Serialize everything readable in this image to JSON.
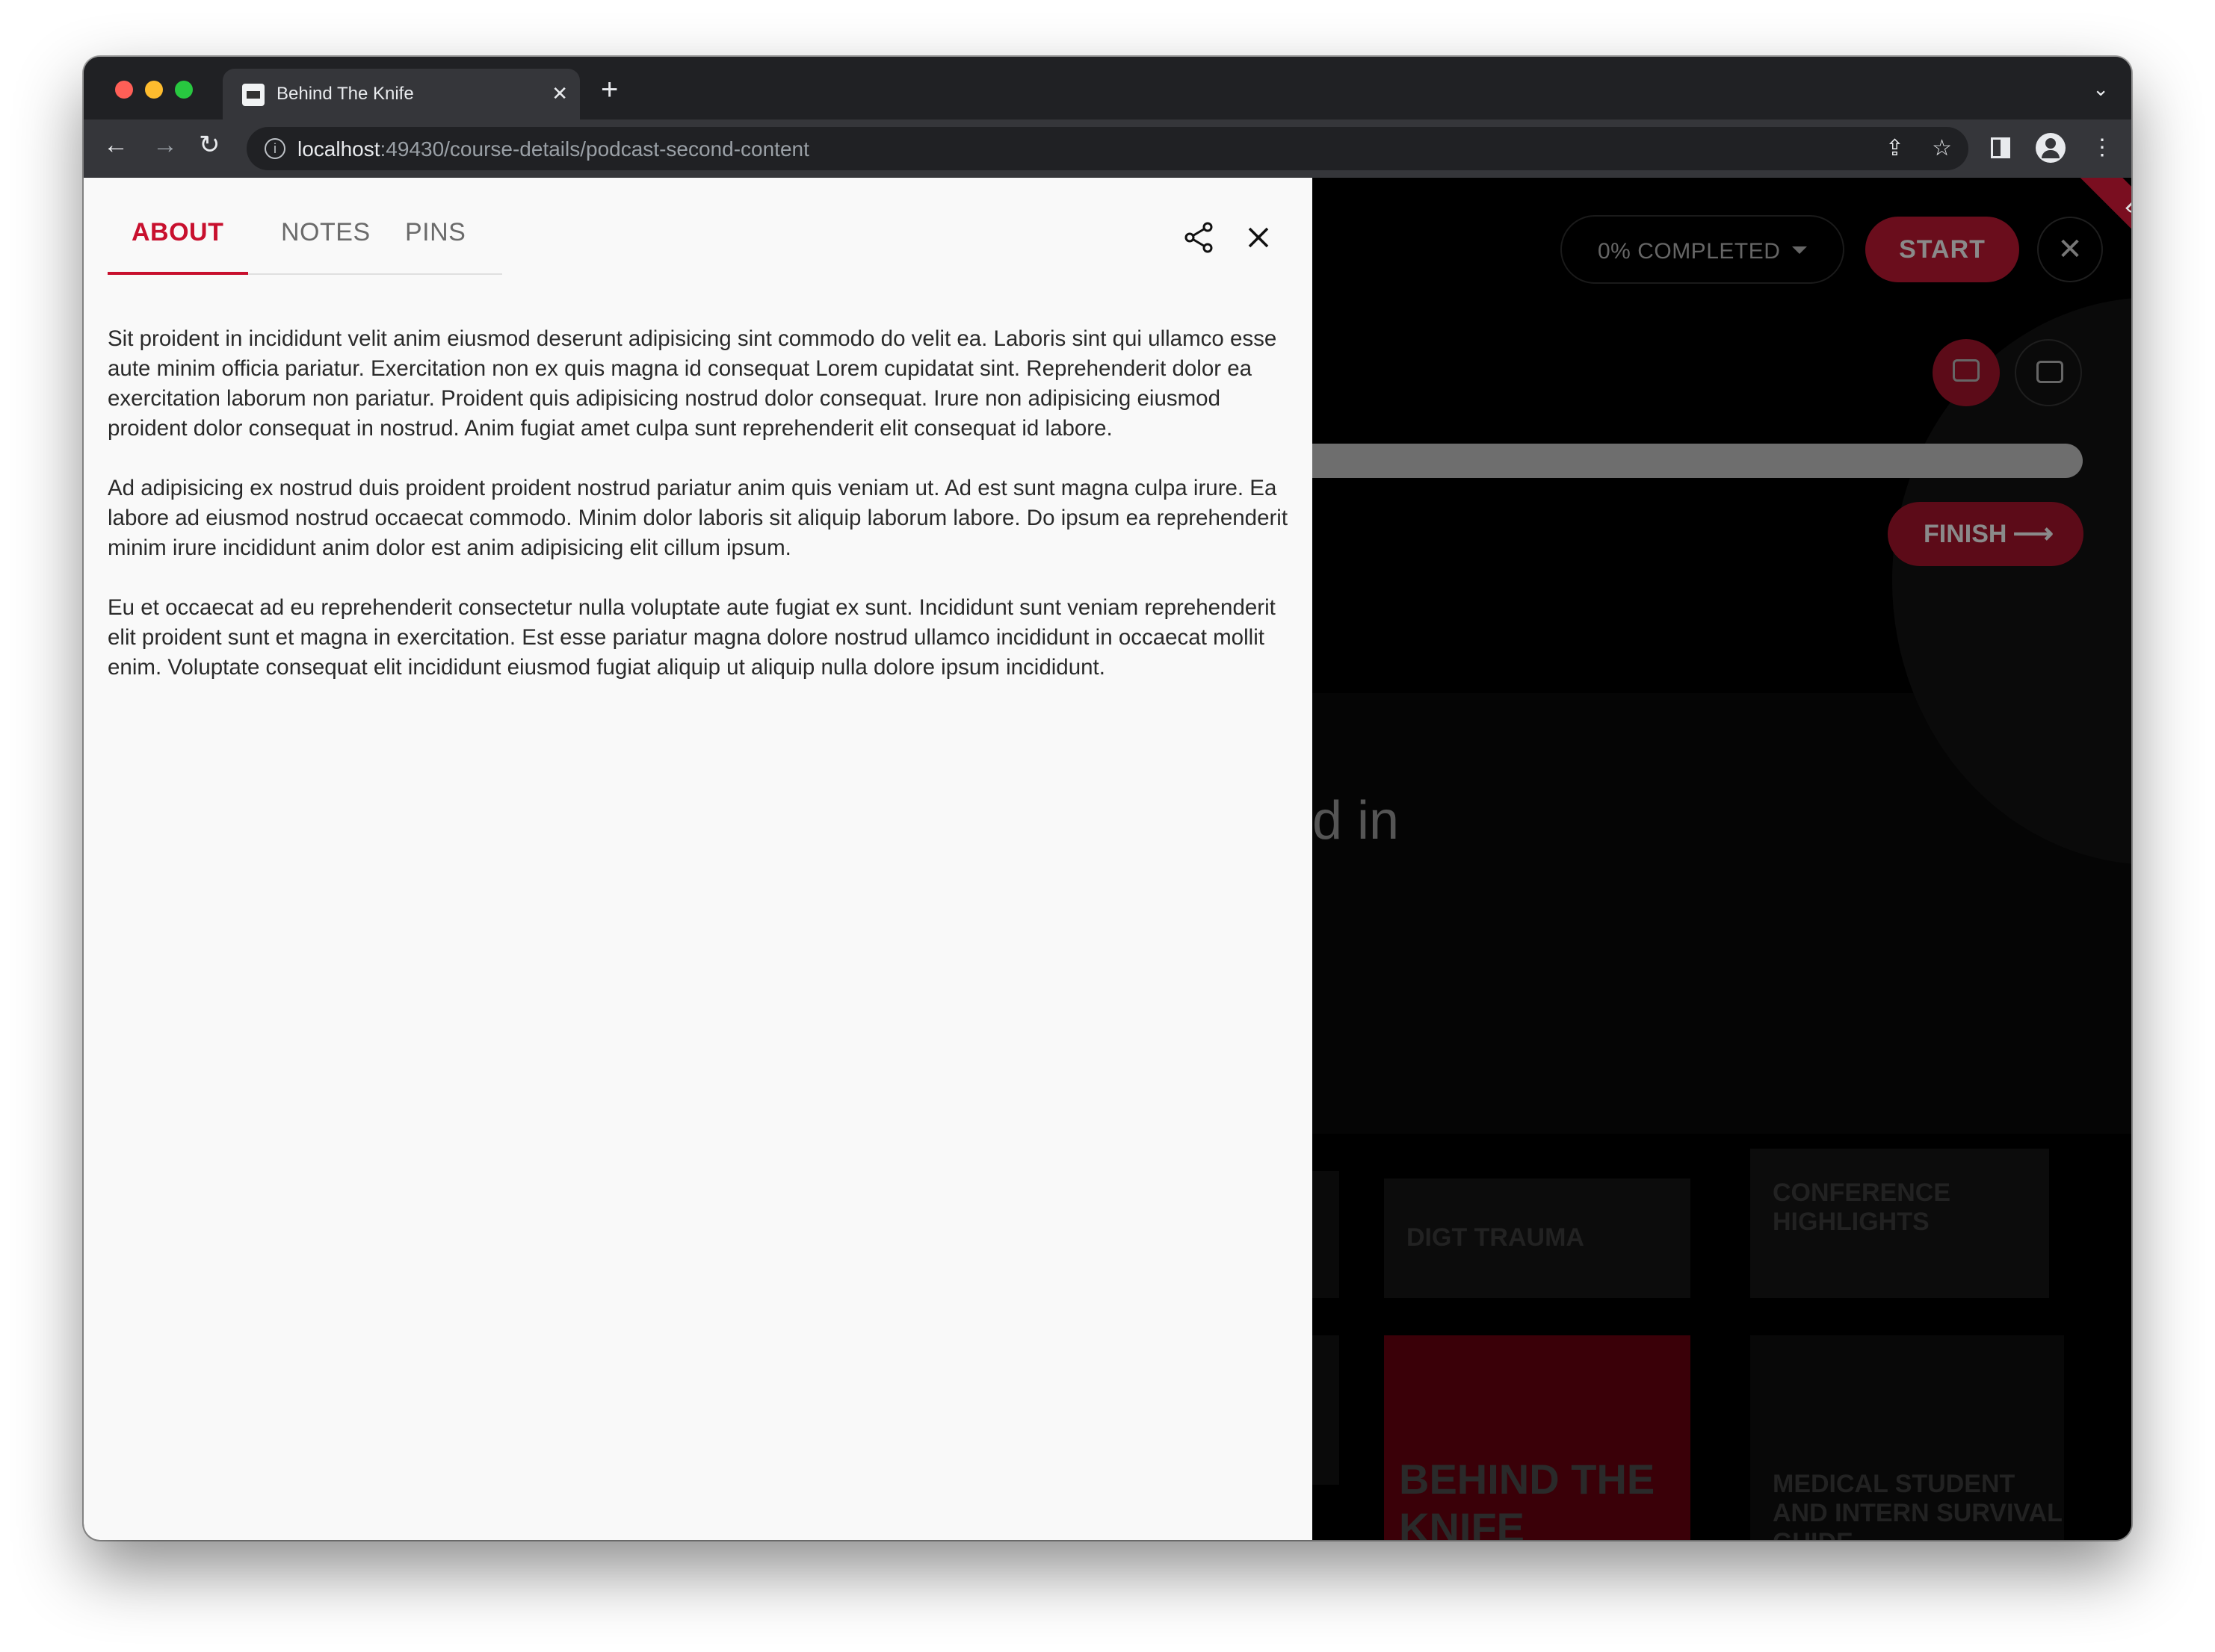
{
  "browser": {
    "tab_title": "Behind The Knife",
    "url_host": "localhost",
    "url_path": ":49430/course-details/podcast-second-content"
  },
  "drawer": {
    "tabs": [
      "ABOUT",
      "NOTES",
      "PINS"
    ],
    "active_tab": "ABOUT",
    "paragraphs": [
      "Sit proident in incididunt velit anim eiusmod deserunt adipisicing sint commodo do velit ea. Laboris sint qui ullamco esse aute minim officia pariatur. Exercitation non ex quis magna id consequat Lorem cupidatat sint. Reprehenderit dolor ea exercitation laborum non pariatur. Proident quis adipisicing nostrud dolor consequat. Irure non adipisicing eiusmod proident dolor consequat in nostrud. Anim fugiat amet culpa sunt reprehenderit elit consequat id labore.",
      "Ad adipisicing ex nostrud duis proident proident nostrud pariatur anim quis veniam ut. Ad est sunt magna culpa irure. Ea labore ad eiusmod nostrud occaecat commodo. Minim dolor laboris sit aliquip laborum labore. Do ipsum ea reprehenderit minim irure incididunt anim dolor est anim adipisicing elit cillum ipsum.",
      "Eu et occaecat ad eu reprehenderit consectetur nulla voluptate aute fugiat ex sunt. Incididunt sunt veniam reprehenderit elit proident sunt et magna in exercitation. Est esse pariatur magna dolore nostrud ullamco incididunt in occaecat mollit enim. Voluptate consequat elit incididunt eiusmod fugiat aliquip ut aliquip nulla dolore ipsum incididunt."
    ]
  },
  "background_page": {
    "completed_label": "0% COMPLETED",
    "start_label": "START",
    "finish_label": "FINISH",
    "dev_badge": "DEV",
    "heading_fragment": "d in",
    "cards": [
      "DIGT TRAUMA",
      "CONFERENCE HIGHLIGHTS",
      "BEHIND THE KNIFE",
      "MEDICAL STUDENT AND INTERN SURVIVAL GUIDE"
    ]
  },
  "colors": {
    "accent": "#c8102e",
    "drawer_bg": "#f9f9f9",
    "browser_chrome": "#35363a"
  }
}
